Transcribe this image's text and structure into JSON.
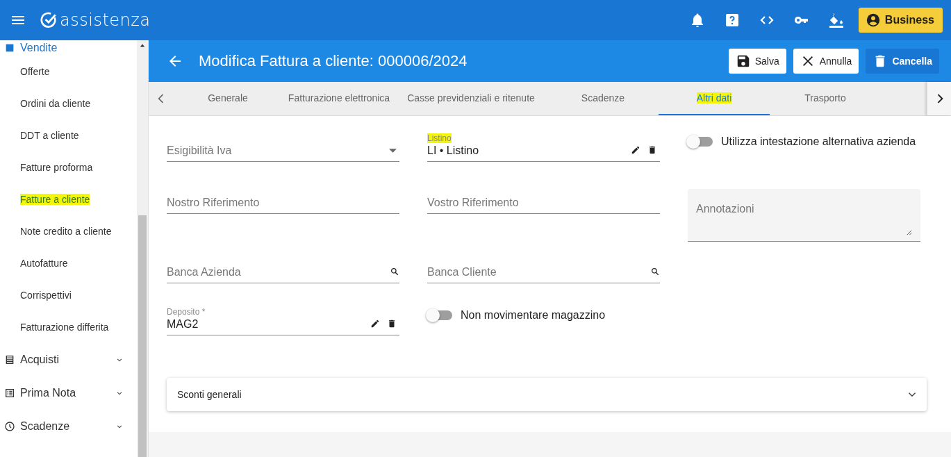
{
  "app": {
    "logo_text": "assistenza",
    "plan_button": "Business"
  },
  "sidebar": {
    "items": [
      {
        "kind": "group",
        "label": "Vendite",
        "expanded": true
      },
      {
        "kind": "link",
        "label": "Offerte",
        "highlighted": false
      },
      {
        "kind": "link",
        "label": "Ordini da cliente",
        "highlighted": false
      },
      {
        "kind": "link",
        "label": "DDT a cliente",
        "highlighted": false
      },
      {
        "kind": "link",
        "label": "Fatture proforma",
        "highlighted": false
      },
      {
        "kind": "link",
        "label": "Fatture a cliente",
        "highlighted": true
      },
      {
        "kind": "link",
        "label": "Note credito a cliente",
        "highlighted": false
      },
      {
        "kind": "link",
        "label": "Autofatture",
        "highlighted": false
      },
      {
        "kind": "link",
        "label": "Corrispettivi",
        "highlighted": false
      },
      {
        "kind": "link",
        "label": "Fatturazione differita",
        "highlighted": false
      },
      {
        "kind": "group",
        "label": "Acquisti",
        "expanded": false
      },
      {
        "kind": "group",
        "label": "Prima Nota",
        "expanded": false
      },
      {
        "kind": "group",
        "label": "Scadenze",
        "expanded": false
      }
    ]
  },
  "page": {
    "title": "Modifica Fattura a cliente: 000006/2024",
    "buttons": [
      {
        "kind": "save",
        "label": "Salva"
      },
      {
        "kind": "cancel",
        "label": "Annulla"
      },
      {
        "kind": "delete",
        "label": "Cancella"
      }
    ]
  },
  "tabs": [
    {
      "label": "Generale",
      "selected": false,
      "highlighted": false
    },
    {
      "label": "Fatturazione elettronica",
      "selected": false,
      "highlighted": false
    },
    {
      "label": "Casse previdenziali e ritenute",
      "selected": false,
      "highlighted": false
    },
    {
      "label": "Scadenze",
      "selected": false,
      "highlighted": false
    },
    {
      "label": "Altri dati",
      "selected": true,
      "highlighted": true
    },
    {
      "label": "Trasporto",
      "selected": false,
      "highlighted": false
    }
  ],
  "form": {
    "rows": [
      [
        {
          "kind": "select",
          "label": "Esigibilità Iva"
        },
        {
          "kind": "reference",
          "label": "Listino",
          "value": "LI • Listino",
          "highlighted": true
        },
        {
          "kind": "toggle",
          "label": "Utilizza intestazione alternativa azienda",
          "on": false
        }
      ],
      [
        {
          "kind": "text",
          "label": "Nostro Riferimento"
        },
        {
          "kind": "text",
          "label": "Vostro Riferimento"
        },
        {
          "kind": "textarea",
          "label": "Annotazioni"
        }
      ],
      [
        {
          "kind": "lookup",
          "label": "Banca Azienda"
        },
        {
          "kind": "lookup",
          "label": "Banca Cliente"
        }
      ],
      [
        {
          "kind": "reference",
          "label": "Deposito *",
          "value": "MAG2",
          "highlighted": false
        },
        {
          "kind": "toggle",
          "label": "Non movimentare magazzino",
          "on": false
        }
      ]
    ],
    "panel": {
      "label": "Sconti generali",
      "expanded": false
    }
  }
}
